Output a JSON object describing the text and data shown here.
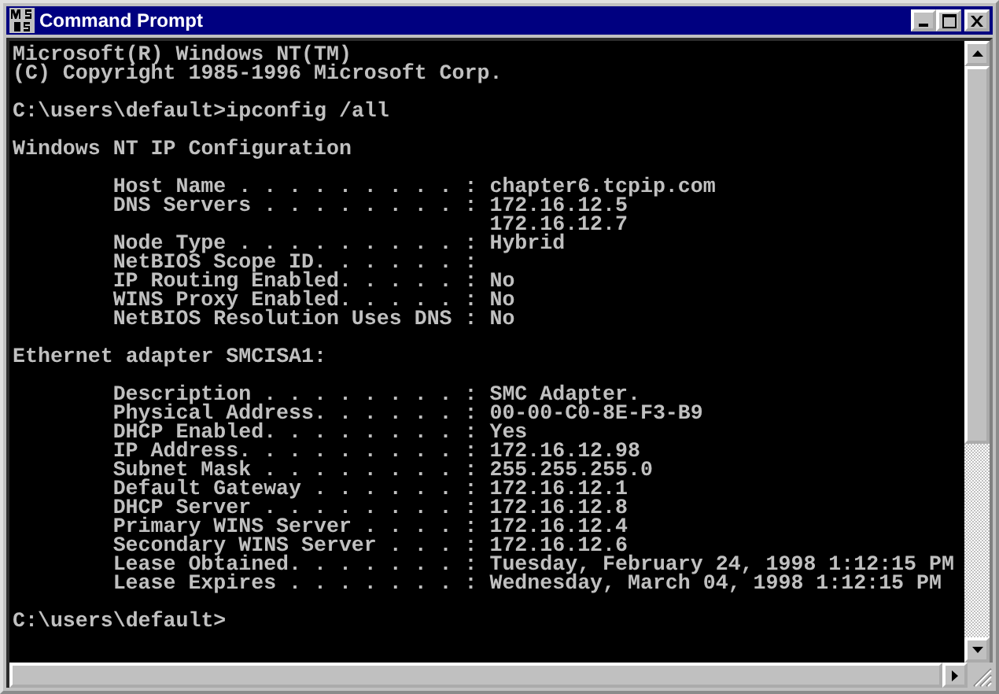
{
  "window": {
    "title": "Command Prompt"
  },
  "console": {
    "blocks": [
      [
        {
          "kind": "plain",
          "text": "Microsoft(R) Windows NT(TM)"
        },
        {
          "kind": "plain",
          "text": "(C) Copyright 1985-1996 Microsoft Corp."
        }
      ],
      [
        {
          "kind": "plain",
          "text": "C:\\users\\default>ipconfig /all"
        }
      ],
      [
        {
          "kind": "plain",
          "text": "Windows NT IP Configuration"
        }
      ],
      [
        {
          "kind": "entry",
          "text": "Host Name . . . . . . . . . : chapter6.tcpip.com"
        },
        {
          "kind": "entry",
          "text": "DNS Servers . . . . . . . . : 172.16.12.5"
        },
        {
          "kind": "continuation",
          "text": "172.16.12.7"
        },
        {
          "kind": "entry",
          "text": "Node Type . . . . . . . . . : Hybrid"
        },
        {
          "kind": "entry",
          "text": "NetBIOS Scope ID. . . . . . :"
        },
        {
          "kind": "entry",
          "text": "IP Routing Enabled. . . . . : No"
        },
        {
          "kind": "entry",
          "text": "WINS Proxy Enabled. . . . . : No"
        },
        {
          "kind": "entry",
          "text": "NetBIOS Resolution Uses DNS : No"
        }
      ],
      [
        {
          "kind": "plain",
          "text": "Ethernet adapter SMCISA1:"
        }
      ],
      [
        {
          "kind": "entry",
          "text": "Description . . . . . . . . : SMC Adapter."
        },
        {
          "kind": "entry",
          "text": "Physical Address. . . . . . : 00-00-C0-8E-F3-B9"
        },
        {
          "kind": "entry",
          "text": "DHCP Enabled. . . . . . . . : Yes"
        },
        {
          "kind": "entry",
          "text": "IP Address. . . . . . . . . : 172.16.12.98"
        },
        {
          "kind": "entry",
          "text": "Subnet Mask . . . . . . . . : 255.255.255.0"
        },
        {
          "kind": "entry",
          "text": "Default Gateway . . . . . . : 172.16.12.1"
        },
        {
          "kind": "entry",
          "text": "DHCP Server . . . . . . . . : 172.16.12.8"
        },
        {
          "kind": "entry",
          "text": "Primary WINS Server . . . . : 172.16.12.4"
        },
        {
          "kind": "entry",
          "text": "Secondary WINS Server . . . : 172.16.12.6"
        },
        {
          "kind": "entry",
          "text": "Lease Obtained. . . . . . . : Tuesday, February 24, 1998 1:12:15 PM"
        },
        {
          "kind": "entry",
          "text": "Lease Expires . . . . . . . : Wednesday, March 04, 1998 1:12:15 PM"
        }
      ],
      [
        {
          "kind": "plain",
          "text": "C:\\users\\default>"
        }
      ]
    ]
  }
}
